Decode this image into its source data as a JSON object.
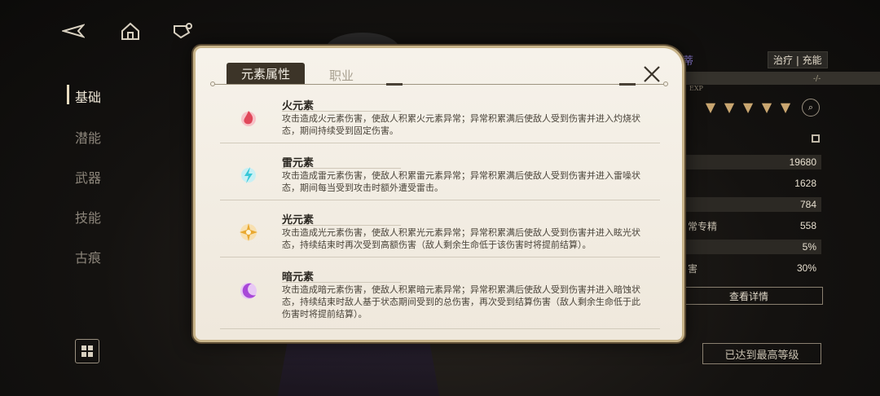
{
  "top_icons": [
    "back-arrow-icon",
    "home-icon",
    "chat-icon"
  ],
  "side_menu": {
    "items": [
      {
        "label": "基础",
        "active": true
      },
      {
        "label": "潜能",
        "active": false
      },
      {
        "label": "武器",
        "active": false
      },
      {
        "label": "技能",
        "active": false
      },
      {
        "label": "古痕",
        "active": false
      }
    ]
  },
  "right_panel": {
    "name_fragment": "蒂",
    "role": "治疗 | 充能",
    "exp_label": "EXP",
    "exp_value": "-/-",
    "stats": [
      {
        "label": "",
        "value": "19680"
      },
      {
        "label": "",
        "value": "1628"
      },
      {
        "label": "",
        "value": "784"
      },
      {
        "label": "常专精",
        "value": "558"
      },
      {
        "label": "",
        "value": "5%"
      },
      {
        "label": "害",
        "value": "30%"
      }
    ],
    "detail_button": "查看详情",
    "max_level_button": "已达到最高等级"
  },
  "modal": {
    "tabs": [
      {
        "label": "元素属性",
        "active": true
      },
      {
        "label": "职业",
        "active": false
      }
    ],
    "elements": [
      {
        "name": "火元素",
        "icon": "fire-element-icon",
        "color": "#e0485a",
        "desc": "攻击造成火元素伤害，使敌人积累火元素异常；异常积累满后使敌人受到伤害并进入灼烧状态，期间持续受到固定伤害。"
      },
      {
        "name": "雷元素",
        "icon": "thunder-element-icon",
        "color": "#38c8d8",
        "desc": "攻击造成雷元素伤害，使敌人积累雷元素异常；异常积累满后使敌人受到伤害并进入雷噪状态，期间每当受到攻击时额外遭受雷击。"
      },
      {
        "name": "光元素",
        "icon": "light-element-icon",
        "color": "#e8a830",
        "desc": "攻击造成光元素伤害，使敌人积累光元素异常；异常积累满后使敌人受到伤害并进入眩光状态，持续结束时再次受到高额伤害（敌人剩余生命低于该伤害时将提前结算）。"
      },
      {
        "name": "暗元素",
        "icon": "dark-element-icon",
        "color": "#a848d8",
        "desc": "攻击造成暗元素伤害，使敌人积累暗元素异常；异常积累满后使敌人受到伤害并进入暗蚀状态，持续结束时敌人基于状态期间受到的总伤害，再次受到结算伤害（敌人剩余生命低于此伤害时将提前结算）。"
      }
    ]
  }
}
